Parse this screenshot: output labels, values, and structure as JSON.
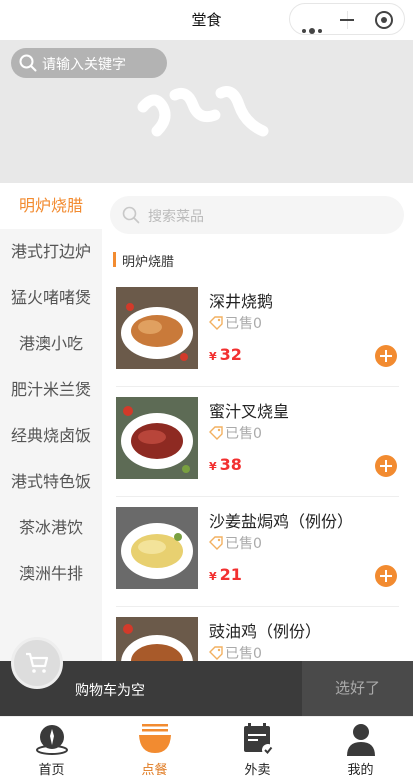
{
  "header": {
    "title": "堂食"
  },
  "banner": {
    "search_placeholder": "请输入关键字"
  },
  "categories": [
    {
      "label": "明炉烧腊",
      "active": true
    },
    {
      "label": "港式打边炉"
    },
    {
      "label": "猛火啫啫煲"
    },
    {
      "label": "港澳小吃"
    },
    {
      "label": "肥汁米兰煲"
    },
    {
      "label": "经典烧卤饭"
    },
    {
      "label": "港式特色饭"
    },
    {
      "label": "茶冰港饮"
    },
    {
      "label": "澳洲牛排"
    }
  ],
  "dish_search": {
    "placeholder": "搜索菜品"
  },
  "section": {
    "title": "明炉烧腊"
  },
  "dishes": [
    {
      "name": "深井烧鹅",
      "sold": "已售0",
      "currency": "¥",
      "price": "32"
    },
    {
      "name": "蜜汁叉烧皇",
      "sold": "已售0",
      "currency": "¥",
      "price": "38"
    },
    {
      "name": "沙姜盐焗鸡（例份）",
      "sold": "已售0",
      "currency": "¥",
      "price": "21"
    },
    {
      "name": "豉油鸡（例份）",
      "sold": "已售0",
      "currency": "¥",
      "price": ""
    }
  ],
  "cart": {
    "empty_text": "购物车为空",
    "done_label": "选好了"
  },
  "tabs": [
    {
      "label": "首页",
      "icon": "home-icon"
    },
    {
      "label": "点餐",
      "icon": "bowl-icon",
      "active": true
    },
    {
      "label": "外卖",
      "icon": "calendar-icon"
    },
    {
      "label": "我的",
      "icon": "person-icon"
    }
  ],
  "colors": {
    "accent": "#f28b30",
    "price": "#f23030",
    "cart_bar": "#3b3b3b"
  }
}
